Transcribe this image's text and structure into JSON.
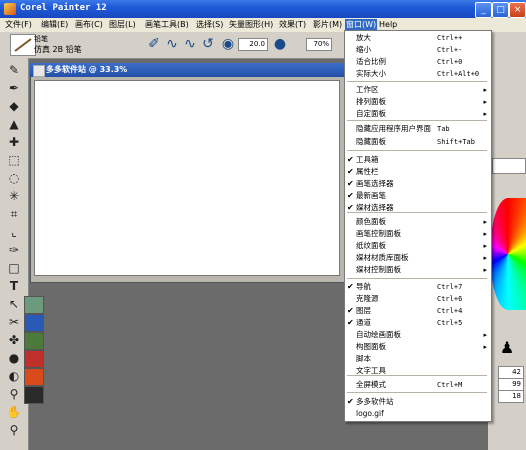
{
  "window": {
    "title": "Corel Painter 12",
    "min": "_",
    "max": "□",
    "close": "×"
  },
  "menubar": [
    {
      "label": "文件(F)"
    },
    {
      "label": "编辑(E)"
    },
    {
      "label": "画布(C)"
    },
    {
      "label": "图层(L)"
    },
    {
      "label": "画笔工具(B)"
    },
    {
      "label": "选择(S)"
    },
    {
      "label": "矢量图形(H)"
    },
    {
      "label": "效果(T)"
    },
    {
      "label": "影片(M)"
    },
    {
      "label": "窗口(W)"
    },
    {
      "label": "Help"
    }
  ],
  "propbar": {
    "category": "铅笔",
    "variant": "仿真 2B 铅笔",
    "size": "20.0",
    "opacity": "70%"
  },
  "document": {
    "title": "多多软件站 @ 33.3%"
  },
  "window_menu": {
    "items": [
      {
        "label": "放大",
        "shortcut": "Ctrl++"
      },
      {
        "label": "缩小",
        "shortcut": "Ctrl+-"
      },
      {
        "label": "适合比例",
        "shortcut": "Ctrl+0"
      },
      {
        "label": "实际大小",
        "shortcut": "Ctrl+Alt+0"
      },
      {
        "label": "工作区",
        "arrow": "▸"
      },
      {
        "label": "排列面板",
        "arrow": "▸"
      },
      {
        "label": "自定面板",
        "arrow": "▸"
      },
      {
        "label": "隐藏应用程序用户界面",
        "shortcut": "Tab"
      },
      {
        "label": "隐藏面板",
        "shortcut": "Shift+Tab"
      },
      {
        "label": "工具箱",
        "check": "✔"
      },
      {
        "label": "属性栏",
        "check": "✔"
      },
      {
        "label": "画笔选择器",
        "check": "✔"
      },
      {
        "label": "最新画笔",
        "check": "✔"
      },
      {
        "label": "媒材选择器",
        "check": "✔"
      },
      {
        "label": "颜色面板",
        "arrow": "▸"
      },
      {
        "label": "画笔控制面板",
        "arrow": "▸"
      },
      {
        "label": "纸纹面板",
        "arrow": "▸"
      },
      {
        "label": "媒材材质库面板",
        "arrow": "▸"
      },
      {
        "label": "媒材控制面板",
        "arrow": "▸"
      },
      {
        "label": "导航",
        "shortcut": "Ctrl+7",
        "check": "✔"
      },
      {
        "label": "克隆源",
        "shortcut": "Ctrl+6"
      },
      {
        "label": "图层",
        "shortcut": "Ctrl+4",
        "check": "✔"
      },
      {
        "label": "通道",
        "shortcut": "Ctrl+5",
        "check": "✔"
      },
      {
        "label": "自动绘画面板",
        "arrow": "▸"
      },
      {
        "label": "构图面板",
        "arrow": "▸"
      },
      {
        "label": "脚本"
      },
      {
        "label": "文字工具"
      },
      {
        "label": "全屏模式",
        "shortcut": "Ctrl+M"
      },
      {
        "label": "多多软件站",
        "check": "✔"
      },
      {
        "label": "logo.gif"
      }
    ]
  },
  "right_values": {
    "v1": "42",
    "v2": "99",
    "v3": "18"
  }
}
